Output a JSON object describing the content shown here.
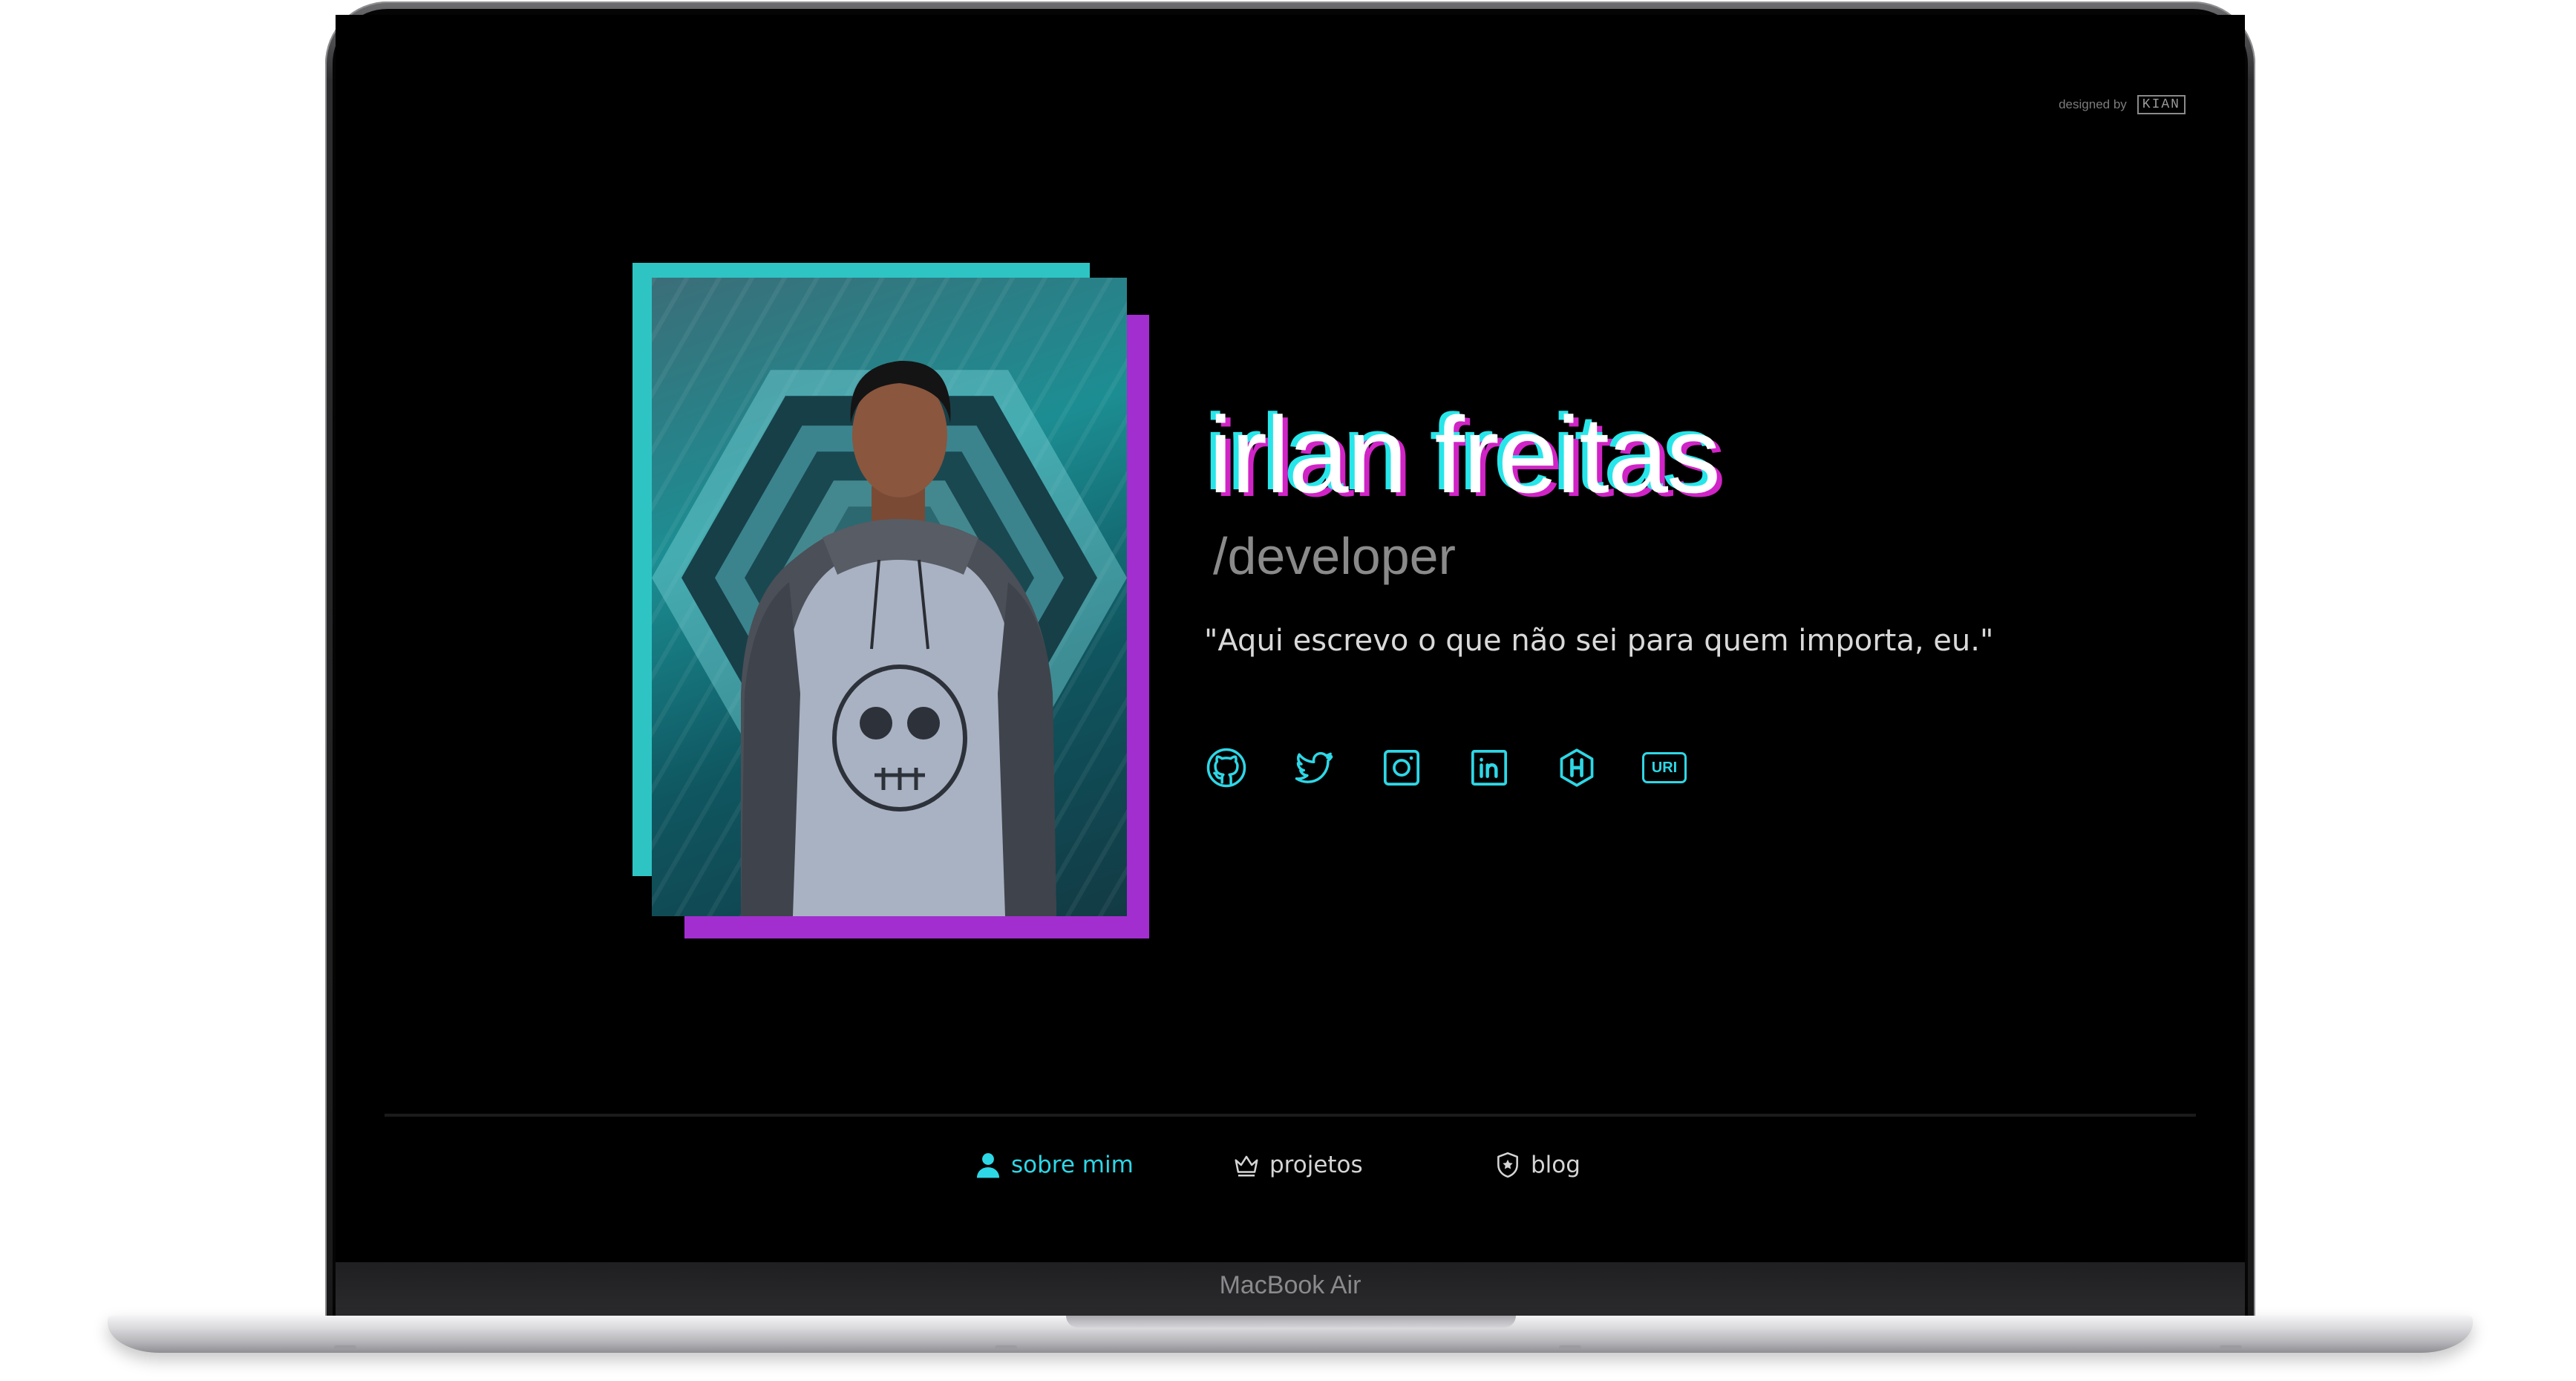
{
  "device": {
    "label": "MacBook Air"
  },
  "credit": {
    "prefix": "designed by",
    "logo": "KIAN"
  },
  "profile": {
    "name": "irlan freitas",
    "role": "/developer",
    "quote": "\"Aqui escrevo o que não sei para quem importa, eu.\""
  },
  "socials": [
    {
      "icon": "github-icon"
    },
    {
      "icon": "twitter-icon"
    },
    {
      "icon": "instagram-icon"
    },
    {
      "icon": "linkedin-icon"
    },
    {
      "icon": "hackerrank-icon"
    },
    {
      "icon": "uri-icon",
      "label": "URI"
    }
  ],
  "nav": [
    {
      "label": "sobre mim",
      "icon": "user-icon",
      "active": true
    },
    {
      "label": "projetos",
      "icon": "crown-icon",
      "active": false
    },
    {
      "label": "blog",
      "icon": "shield-star-icon",
      "active": false
    }
  ],
  "colors": {
    "accent": "#2ed7e6",
    "glitch_cyan": "#27e6ea",
    "glitch_pink": "#d024c6",
    "frame_cyan": "#2ec4c4",
    "frame_pink": "#a32ed0",
    "background": "#000000"
  }
}
